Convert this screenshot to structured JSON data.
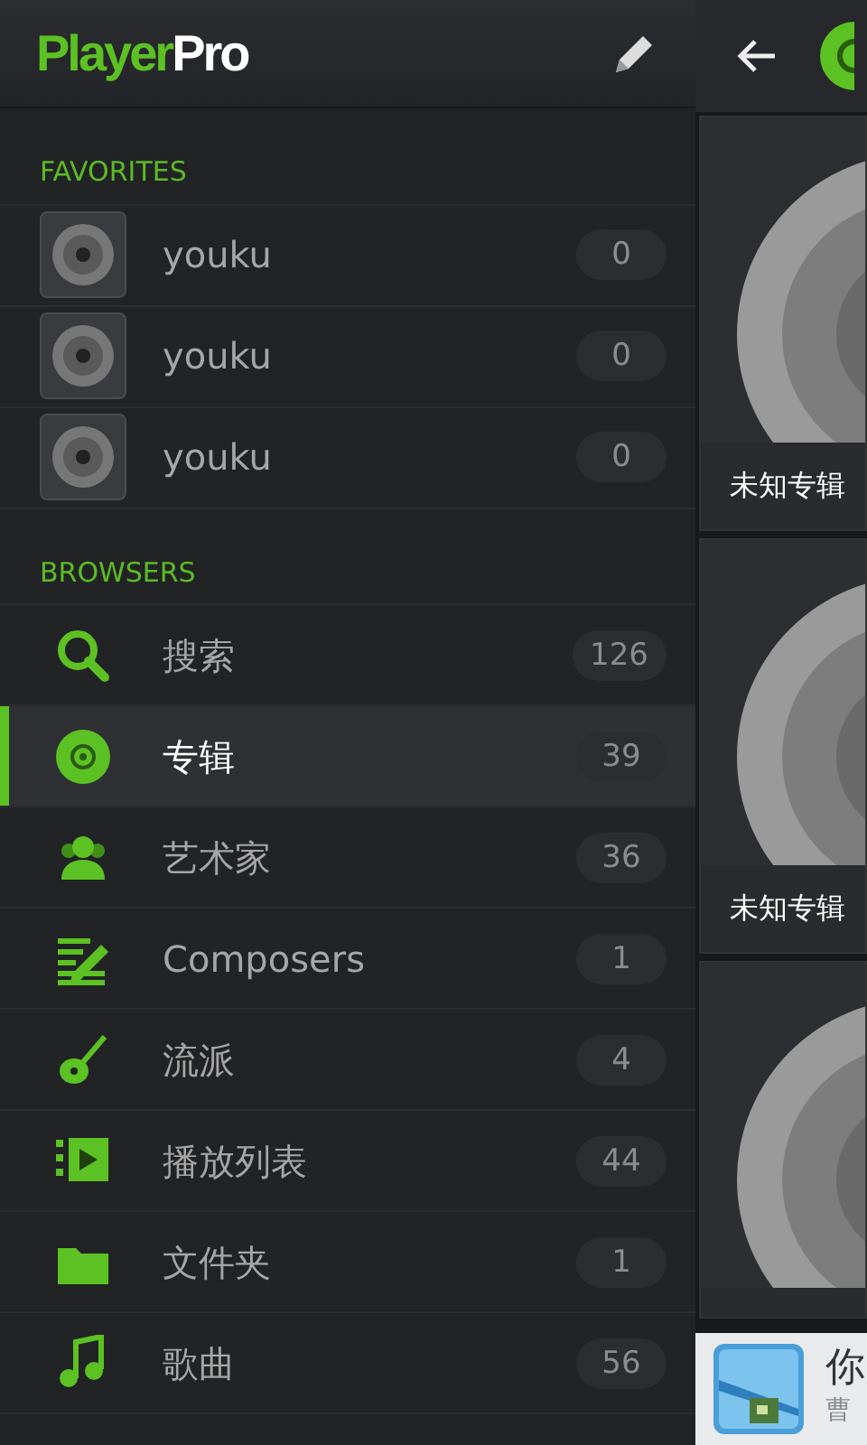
{
  "logo": {
    "main": "Player",
    "accent": "Pro"
  },
  "favorites": {
    "title": "FAVORITES",
    "items": [
      {
        "label": "youku",
        "count": "0"
      },
      {
        "label": "youku",
        "count": "0"
      },
      {
        "label": "youku",
        "count": "0"
      }
    ]
  },
  "browsers": {
    "title": "BROWSERS",
    "items": [
      {
        "kind": "search",
        "label": "搜索",
        "count": "126",
        "selected": false
      },
      {
        "kind": "album",
        "label": "专辑",
        "count": "39",
        "selected": true
      },
      {
        "kind": "artist",
        "label": "艺术家",
        "count": "36",
        "selected": false
      },
      {
        "kind": "composer",
        "label": "Composers",
        "count": "1",
        "selected": false
      },
      {
        "kind": "genre",
        "label": "流派",
        "count": "4",
        "selected": false
      },
      {
        "kind": "playlist",
        "label": "播放列表",
        "count": "44",
        "selected": false
      },
      {
        "kind": "folder",
        "label": "文件夹",
        "count": "1",
        "selected": false
      },
      {
        "kind": "song",
        "label": "歌曲",
        "count": "56",
        "selected": false
      }
    ]
  },
  "albums": [
    {
      "kind": "album",
      "label": "未知专辑"
    },
    {
      "kind": "album",
      "label": "未知专辑"
    },
    {
      "kind": "picture"
    }
  ],
  "notification": {
    "title": "你",
    "subtitle": "曹"
  }
}
